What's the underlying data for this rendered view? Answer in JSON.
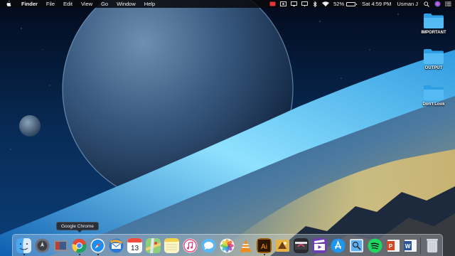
{
  "menubar": {
    "apple_icon": "apple-logo-icon",
    "app_name": "Finder",
    "menus": [
      "File",
      "Edit",
      "View",
      "Go",
      "Window",
      "Help"
    ],
    "status_icons": [
      "cast-icon",
      "screen-record-icon",
      "airplay-icon",
      "display-icon",
      "bluetooth-icon",
      "wifi-icon"
    ],
    "battery_percent": "52%",
    "battery_level": 0.52,
    "clock": "Sat 4:59 PM",
    "user": "Usman J",
    "right_icons": [
      "search-icon",
      "siri-icon",
      "notification-center-icon"
    ]
  },
  "desktop": {
    "folders": [
      {
        "label": "IMPORTANT",
        "icon": "folder-icon"
      },
      {
        "label": "OUTPUT",
        "icon": "folder-icon"
      },
      {
        "label": "Don't Look",
        "icon": "folder-icon"
      }
    ]
  },
  "tooltip": {
    "text": "Google Chrome"
  },
  "dock": {
    "items": [
      {
        "name": "finder",
        "icon": "finder-icon",
        "running": true
      },
      {
        "name": "launchpad",
        "icon": "launchpad-icon",
        "running": false
      },
      {
        "name": "photo-booth",
        "icon": "photo-booth-icon",
        "running": false
      },
      {
        "name": "google-chrome",
        "icon": "chrome-icon",
        "running": true
      },
      {
        "name": "safari",
        "icon": "safari-icon",
        "running": true
      },
      {
        "name": "thunderbird",
        "icon": "mail-icon",
        "running": false
      },
      {
        "name": "calendar",
        "icon": "calendar-icon",
        "running": false,
        "badge": "13"
      },
      {
        "name": "maps",
        "icon": "maps-icon",
        "running": false
      },
      {
        "name": "notes",
        "icon": "notes-icon",
        "running": false
      },
      {
        "name": "itunes",
        "icon": "itunes-icon",
        "running": false
      },
      {
        "name": "messages",
        "icon": "messages-icon",
        "running": false
      },
      {
        "name": "photos",
        "icon": "photos-icon",
        "running": false
      },
      {
        "name": "vlc",
        "icon": "vlc-icon",
        "running": false
      },
      {
        "name": "illustrator",
        "icon": "illustrator-icon",
        "running": true,
        "label": "Ai"
      },
      {
        "name": "photoshop",
        "icon": "photoshop-icon",
        "running": false
      },
      {
        "name": "final-cut-pro",
        "icon": "final-cut-icon",
        "running": false
      },
      {
        "name": "imovie",
        "icon": "imovie-icon",
        "running": false
      },
      {
        "name": "app-store",
        "icon": "app-store-icon",
        "running": false
      },
      {
        "name": "preview",
        "icon": "preview-icon",
        "running": false
      },
      {
        "name": "spotify",
        "icon": "spotify-icon",
        "running": false
      },
      {
        "name": "powerpoint",
        "icon": "powerpoint-icon",
        "running": false,
        "label": "P"
      },
      {
        "name": "word",
        "icon": "word-icon",
        "running": false,
        "label": "W"
      }
    ],
    "trash_icon": "trash-icon"
  }
}
